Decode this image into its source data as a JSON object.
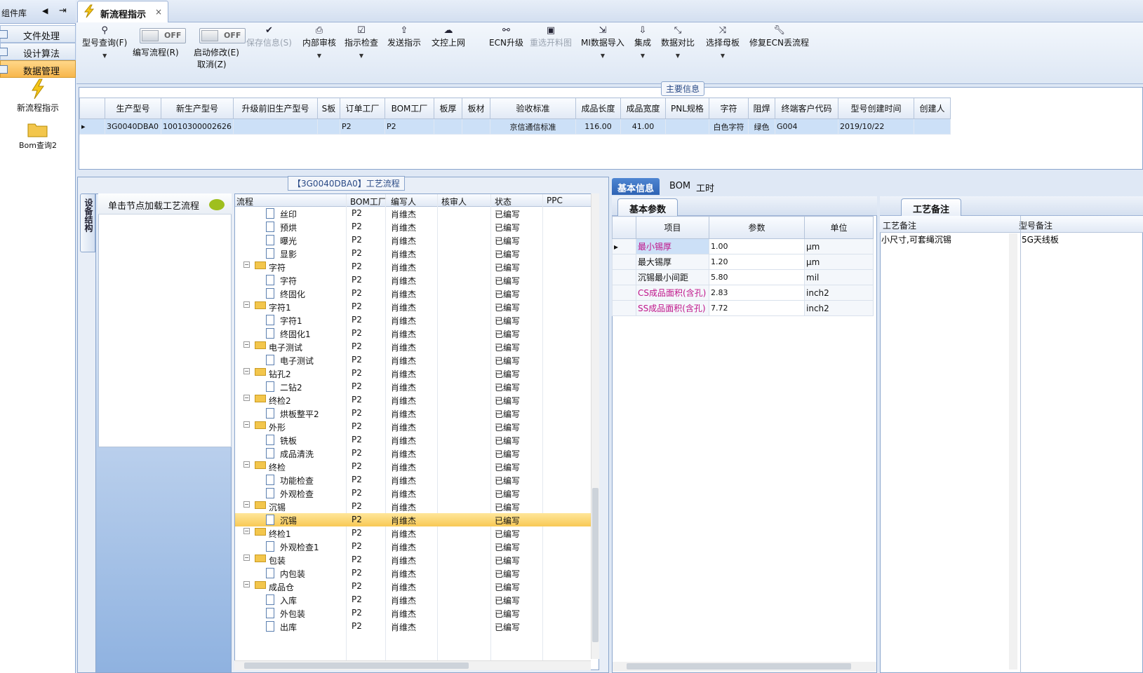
{
  "left": {
    "title": "组件库",
    "nav": [
      "文件处理",
      "设计算法",
      "数据管理"
    ],
    "tools": [
      "新流程指示",
      "Bom查询2"
    ]
  },
  "tab": {
    "label": "新流程指示",
    "close": "×"
  },
  "ribbon": {
    "query": "型号查询(F)",
    "edit_flow": "编写流程(R)",
    "start_edit": "启动修改(E)",
    "cancel": "取消(Z)",
    "toggle_off": "OFF",
    "save": "保存信息(S)",
    "review": "内部审核",
    "check": "指示检查",
    "send": "发送指示",
    "upload": "文控上网",
    "ecn": "ECN升级",
    "reselect": "重选开料图",
    "mi_import": "MI数据导入",
    "integrate": "集成",
    "compare": "数据对比",
    "select_board": "选择母板",
    "fix_ecn": "修复ECN丢流程"
  },
  "main": {
    "title": "主要信息",
    "columns": [
      "生产型号",
      "新生产型号",
      "升级前旧生产型号",
      "S板",
      "订单工厂",
      "BOM工厂",
      "板厚",
      "板材",
      "验收标准",
      "成品长度",
      "成品宽度",
      "PNL规格",
      "字符",
      "阻焊",
      "终端客户代码",
      "型号创建时间",
      "创建人"
    ],
    "row": [
      "3G0040DBA0",
      "10010300002626",
      "",
      "",
      "P2",
      "P2",
      "",
      "",
      "京信通信标准",
      "116.00",
      "41.00",
      "",
      "白色字符",
      "绿色",
      "G004",
      "2019/10/22",
      ""
    ]
  },
  "flow": {
    "title": "【3G0040DBA0】工艺流程",
    "side_tab": "设备结构",
    "hint": "单击节点加载工艺流程",
    "columns": [
      "流程",
      "BOM工厂",
      "编写人",
      "核审人",
      "状态",
      "PPC"
    ],
    "rows": [
      {
        "name": "丝印",
        "lvl": 2,
        "f": "P2",
        "w": "肖维杰",
        "s": "已编写"
      },
      {
        "name": "预烘",
        "lvl": 2,
        "f": "P2",
        "w": "肖维杰",
        "s": "已编写"
      },
      {
        "name": "曝光",
        "lvl": 2,
        "f": "P2",
        "w": "肖维杰",
        "s": "已编写"
      },
      {
        "name": "显影",
        "lvl": 2,
        "f": "P2",
        "w": "肖维杰",
        "s": "已编写"
      },
      {
        "name": "字符",
        "lvl": 1,
        "f": "P2",
        "w": "肖维杰",
        "s": "已编写"
      },
      {
        "name": "字符",
        "lvl": 2,
        "f": "P2",
        "w": "肖维杰",
        "s": "已编写"
      },
      {
        "name": "终固化",
        "lvl": 2,
        "f": "P2",
        "w": "肖维杰",
        "s": "已编写"
      },
      {
        "name": "字符1",
        "lvl": 1,
        "f": "P2",
        "w": "肖维杰",
        "s": "已编写"
      },
      {
        "name": "字符1",
        "lvl": 2,
        "f": "P2",
        "w": "肖维杰",
        "s": "已编写"
      },
      {
        "name": "终固化1",
        "lvl": 2,
        "f": "P2",
        "w": "肖维杰",
        "s": "已编写"
      },
      {
        "name": "电子测试",
        "lvl": 1,
        "f": "P2",
        "w": "肖维杰",
        "s": "已编写"
      },
      {
        "name": "电子测试",
        "lvl": 2,
        "f": "P2",
        "w": "肖维杰",
        "s": "已编写"
      },
      {
        "name": "钻孔2",
        "lvl": 1,
        "f": "P2",
        "w": "肖维杰",
        "s": "已编写"
      },
      {
        "name": "二钻2",
        "lvl": 2,
        "f": "P2",
        "w": "肖维杰",
        "s": "已编写"
      },
      {
        "name": "终检2",
        "lvl": 1,
        "f": "P2",
        "w": "肖维杰",
        "s": "已编写"
      },
      {
        "name": "烘板整平2",
        "lvl": 2,
        "f": "P2",
        "w": "肖维杰",
        "s": "已编写"
      },
      {
        "name": "外形",
        "lvl": 1,
        "f": "P2",
        "w": "肖维杰",
        "s": "已编写"
      },
      {
        "name": "铣板",
        "lvl": 2,
        "f": "P2",
        "w": "肖维杰",
        "s": "已编写"
      },
      {
        "name": "成品清洗",
        "lvl": 2,
        "f": "P2",
        "w": "肖维杰",
        "s": "已编写"
      },
      {
        "name": "终检",
        "lvl": 1,
        "f": "P2",
        "w": "肖维杰",
        "s": "已编写"
      },
      {
        "name": "功能检查",
        "lvl": 2,
        "f": "P2",
        "w": "肖维杰",
        "s": "已编写"
      },
      {
        "name": "外观检查",
        "lvl": 2,
        "f": "P2",
        "w": "肖维杰",
        "s": "已编写"
      },
      {
        "name": "沉锡",
        "lvl": 1,
        "f": "P2",
        "w": "肖维杰",
        "s": "已编写"
      },
      {
        "name": "沉锡",
        "lvl": 2,
        "f": "P2",
        "w": "肖维杰",
        "s": "已编写",
        "sel": true
      },
      {
        "name": "终检1",
        "lvl": 1,
        "f": "P2",
        "w": "肖维杰",
        "s": "已编写"
      },
      {
        "name": "外观检查1",
        "lvl": 2,
        "f": "P2",
        "w": "肖维杰",
        "s": "已编写"
      },
      {
        "name": "包装",
        "lvl": 1,
        "f": "P2",
        "w": "肖维杰",
        "s": "已编写"
      },
      {
        "name": "内包装",
        "lvl": 2,
        "f": "P2",
        "w": "肖维杰",
        "s": "已编写"
      },
      {
        "name": "成品仓",
        "lvl": 1,
        "f": "P2",
        "w": "肖维杰",
        "s": "已编写"
      },
      {
        "name": "入库",
        "lvl": 2,
        "f": "P2",
        "w": "肖维杰",
        "s": "已编写"
      },
      {
        "name": "外包装",
        "lvl": 2,
        "f": "P2",
        "w": "肖维杰",
        "s": "已编写"
      },
      {
        "name": "出库",
        "lvl": 2,
        "f": "P2",
        "w": "肖维杰",
        "s": "已编写"
      }
    ]
  },
  "right": {
    "tabs": [
      "基本信息",
      "BOM",
      "工时"
    ],
    "sub_tab": "基本参数",
    "param_columns": [
      "项目",
      "参数",
      "单位"
    ],
    "params": [
      {
        "item": "最小锡厚",
        "val": "1.00",
        "unit": "μm",
        "pink": true
      },
      {
        "item": "最大锡厚",
        "val": "1.20",
        "unit": "μm",
        "pink": false
      },
      {
        "item": "沉锡最小间距",
        "val": "5.80",
        "unit": "mil",
        "pink": false
      },
      {
        "item": "CS成品面积(含孔)",
        "val": "2.83",
        "unit": "inch2",
        "pink": true
      },
      {
        "item": "SS成品面积(含孔)",
        "val": "7.72",
        "unit": "inch2",
        "pink": true
      }
    ],
    "note_tab": "工艺备注",
    "note_columns": [
      "工艺备注",
      "型号备注"
    ],
    "process_note": "小尺寸,可套绳沉锡",
    "model_note": "5G天线板"
  }
}
